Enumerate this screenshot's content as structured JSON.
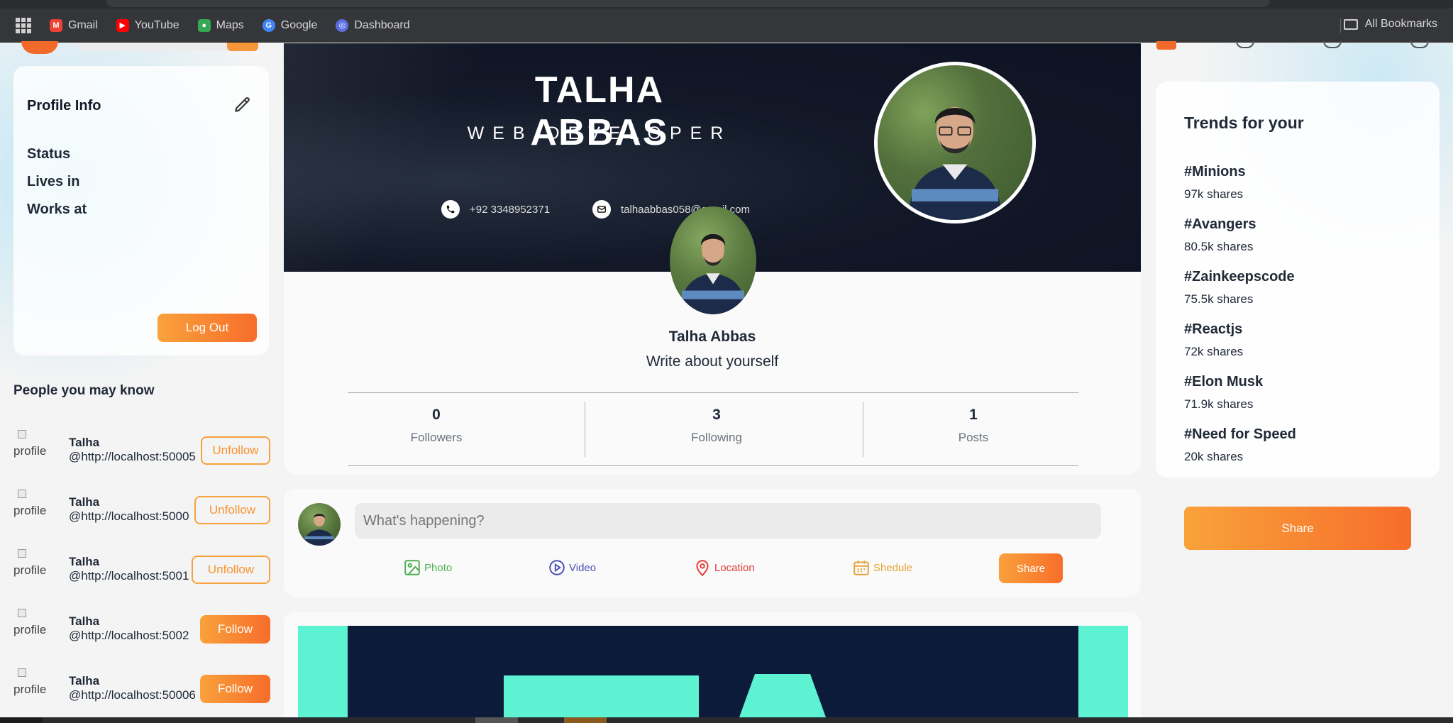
{
  "bookmarks_bar": {
    "items": [
      {
        "label": "Gmail",
        "icon": "gmail-icon",
        "color": "#ea4335"
      },
      {
        "label": "YouTube",
        "icon": "youtube-icon",
        "color": "#ff0000"
      },
      {
        "label": "Maps",
        "icon": "maps-icon",
        "color": "#34a853"
      },
      {
        "label": "Google",
        "icon": "google-icon",
        "color": "#4285f4"
      },
      {
        "label": "Dashboard",
        "icon": "dashboard-icon",
        "color": "#5b6ee1"
      }
    ],
    "all_bookmarks": "All Bookmarks"
  },
  "profile_card": {
    "title": "Profile Info",
    "status_label": "Status",
    "lives_label": "Lives in",
    "works_label": "Works at",
    "logout_label": "Log Out"
  },
  "people": {
    "title": "People you may know",
    "image_alt": "profile",
    "list": [
      {
        "name": "Talha",
        "username": "@http://localhost:50005",
        "action": "Unfollow"
      },
      {
        "name": "Talha",
        "username": "@http://localhost:5000",
        "action": "Unfollow"
      },
      {
        "name": "Talha",
        "username": "@http://localhost:5001",
        "action": "Unfollow"
      },
      {
        "name": "Talha",
        "username": "@http://localhost:5002",
        "action": "Follow"
      },
      {
        "name": "Talha",
        "username": "@http://localhost:50006",
        "action": "Follow"
      }
    ]
  },
  "banner": {
    "name": "TALHA ABBAS",
    "role": "WEB DEVELOPER",
    "phone": "+92 3348952371",
    "email": "talhaabbas058@gmail.com"
  },
  "profile": {
    "name": "Talha Abbas",
    "bio": "Write about yourself",
    "followers_count": "0",
    "followers_label": "Followers",
    "following_count": "3",
    "following_label": "Following",
    "posts_count": "1",
    "posts_label": "Posts"
  },
  "post_share": {
    "placeholder": "What's happening?",
    "photo": "Photo",
    "video": "Video",
    "location": "Location",
    "schedule": "Shedule",
    "share": "Share"
  },
  "trends": {
    "title": "Trends for your",
    "items": [
      {
        "tag": "#Minions",
        "shares": "97k shares"
      },
      {
        "tag": "#Avangers",
        "shares": "80.5k shares"
      },
      {
        "tag": "#Zainkeepscode",
        "shares": "75.5k shares"
      },
      {
        "tag": "#Reactjs",
        "shares": "72k shares"
      },
      {
        "tag": "#Elon Musk",
        "shares": "71.9k shares"
      },
      {
        "tag": "#Need for Speed",
        "shares": "20k shares"
      }
    ],
    "share_button": "Share"
  },
  "colors": {
    "accent_start": "#f9a23b",
    "accent_end": "#f76d2a",
    "photo": "#4caf50",
    "video": "#4a4fb3",
    "location": "#e53935",
    "schedule": "#e5a33a"
  }
}
